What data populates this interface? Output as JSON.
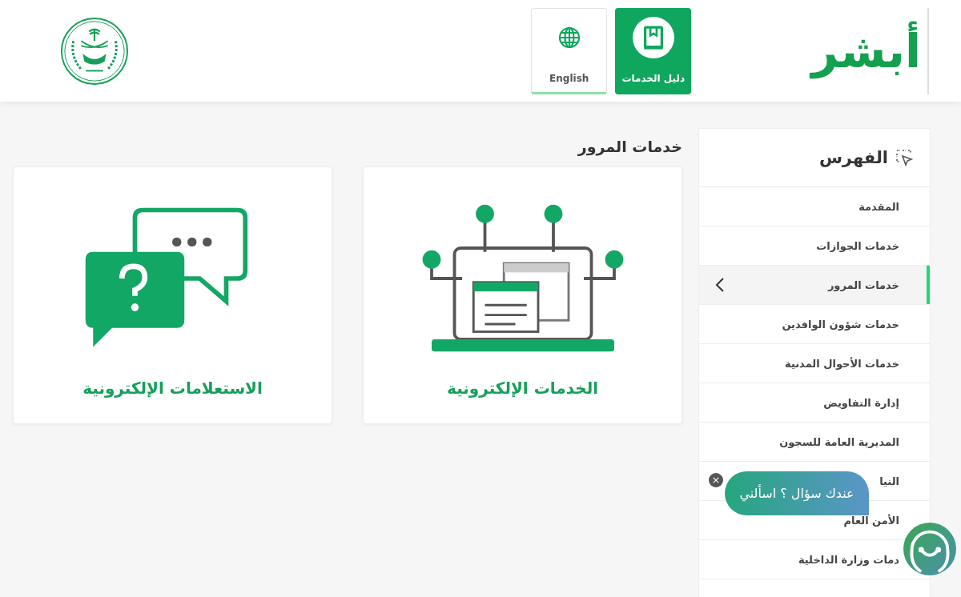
{
  "header": {
    "logo_text": "أبشر",
    "buttons": [
      {
        "kind": "guide",
        "label": "دليل الخدمات",
        "selected": true
      },
      {
        "kind": "language",
        "label": "English",
        "selected": false
      }
    ]
  },
  "sidebar": {
    "title": "الفهرس",
    "items": [
      {
        "label": "المقدمة",
        "selected": false
      },
      {
        "label": "خدمات الجوازات",
        "selected": false
      },
      {
        "label": "خدمات المرور",
        "selected": true
      },
      {
        "label": "خدمات شؤون الوافدين",
        "selected": false
      },
      {
        "label": "خدمات الأحوال المدنية",
        "selected": false
      },
      {
        "label": "إدارة التفاويض",
        "selected": false
      },
      {
        "label": "المديرية العامة للسجون",
        "selected": false
      },
      {
        "label": "النيا",
        "selected": false
      },
      {
        "label": "الأمن العام",
        "selected": false
      },
      {
        "label": "دمات وزارة الداخلية",
        "selected": false
      }
    ]
  },
  "page_title": "خدمات المرور",
  "cards": [
    {
      "kind": "services",
      "label": "الخدمات الإلكترونية"
    },
    {
      "kind": "inquiries",
      "label": "الاستعلامات الإلكترونية"
    }
  ],
  "chat": {
    "prompt": "عندك سؤال ؟ اسألني",
    "close": "×"
  }
}
